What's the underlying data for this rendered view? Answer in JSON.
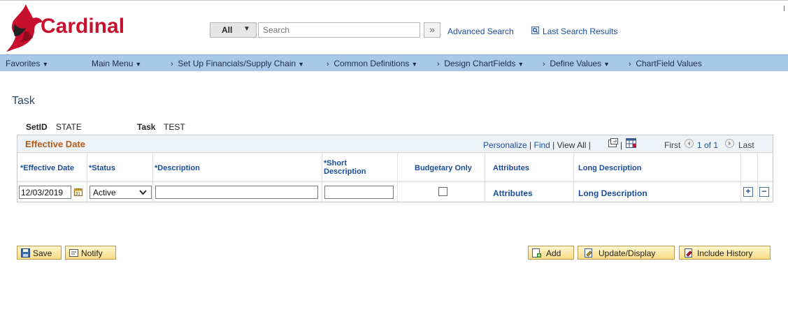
{
  "header": {
    "logo_text": "Cardinal",
    "search": {
      "scope_value": "All",
      "placeholder": "Search",
      "go_symbol": "»"
    },
    "advanced_search_label": "Advanced Search",
    "last_search_results_label": "Last Search Results"
  },
  "nav": {
    "favorites": "Favorites",
    "main_menu": "Main Menu",
    "breadcrumbs": [
      "Set Up Financials/Supply Chain",
      "Common Definitions",
      "Design ChartFields",
      "Define Values",
      "ChartField Values"
    ]
  },
  "page": {
    "title": "Task",
    "setid_label": "SetID",
    "setid_value": "STATE",
    "task_label": "Task",
    "task_value": "TEST"
  },
  "grid": {
    "title": "Effective Date",
    "personalize": "Personalize",
    "find": "Find",
    "view_all": "View All",
    "first": "First",
    "range": "1 of 1",
    "last": "Last",
    "columns": {
      "effective_date": "*Effective Date",
      "status": "*Status",
      "description": "*Description",
      "short_description_1": "*Short",
      "short_description_2": "Description",
      "budgetary_only": "Budgetary Only",
      "attributes": "Attributes",
      "long_description": "Long Description"
    },
    "row": {
      "effective_date": "12/03/2019",
      "status": "Active",
      "description": "",
      "short_description": "",
      "budgetary_only": false,
      "attributes_link": "Attributes",
      "long_description_link": "Long Description",
      "add_symbol": "+",
      "delete_symbol": "−"
    }
  },
  "buttons": {
    "save": "Save",
    "notify": "Notify",
    "add": "Add",
    "update_display": "Update/Display",
    "include_history": "Include History"
  },
  "colors": {
    "brand_red": "#c8102e",
    "nav_blue": "#a8c8ea",
    "link_blue": "#1a4c9a",
    "grid_title_orange": "#b55a14",
    "button_yellow": "#f7dc84"
  }
}
